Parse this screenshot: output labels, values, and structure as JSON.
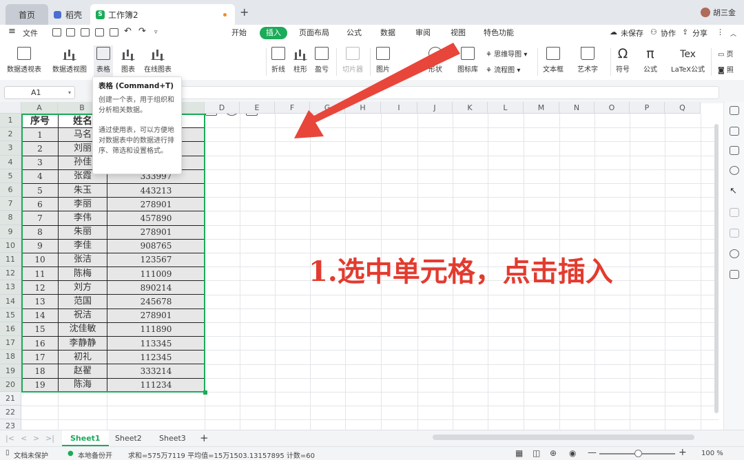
{
  "tabs": {
    "home": "首页",
    "doc": "稻壳",
    "workbook": "工作簿2",
    "new_tab": "+"
  },
  "user": {
    "name": "胡三金"
  },
  "menu": {
    "file": "文件",
    "tabs": [
      "开始",
      "插入",
      "页面布局",
      "公式",
      "数据",
      "审阅",
      "视图",
      "特色功能"
    ],
    "active_tab": "插入",
    "right": {
      "unsaved": "未保存",
      "collab": "协作",
      "share": "分享",
      "more": "⋮"
    }
  },
  "ribbon": {
    "items": [
      "数据透视表",
      "数据透视图",
      "表格",
      "图表",
      "在线图表",
      "折线",
      "柱形",
      "盈亏",
      "切片器",
      "图片",
      "形状",
      "图标库",
      "文本框",
      "艺术字",
      "符号",
      "公式",
      "LaTeX公式",
      "页",
      "照"
    ],
    "mindmap": "思维导图",
    "flowchart": "流程图"
  },
  "formula_bar": {
    "name_box": "A1"
  },
  "tooltip": {
    "title": "表格 (Command+T)",
    "line1": "创建一个表，用于组织和分析相关数据。",
    "line2": "通过使用表，可以方便地对数据表中的数据进行排序、筛选和设置格式。"
  },
  "grid": {
    "columns": [
      "A",
      "B",
      "C",
      "D",
      "E",
      "F",
      "G",
      "H",
      "I",
      "J",
      "K",
      "L",
      "M",
      "N",
      "O",
      "P",
      "Q"
    ],
    "rows": [
      "1",
      "2",
      "3",
      "4",
      "5",
      "6",
      "7",
      "8",
      "9",
      "10",
      "11",
      "12",
      "13",
      "14",
      "15",
      "16",
      "17",
      "18",
      "19",
      "20",
      "21",
      "22",
      "23"
    ],
    "header": [
      "序号",
      "姓名",
      ""
    ],
    "data": [
      [
        "1",
        "马名",
        ""
      ],
      [
        "2",
        "刘丽",
        ""
      ],
      [
        "3",
        "孙佳",
        ""
      ],
      [
        "4",
        "张霞",
        "333997"
      ],
      [
        "5",
        "朱玉",
        "443213"
      ],
      [
        "6",
        "李丽",
        "278901"
      ],
      [
        "7",
        "李伟",
        "457890"
      ],
      [
        "8",
        "朱丽",
        "278901"
      ],
      [
        "9",
        "李佳",
        "908765"
      ],
      [
        "10",
        "张洁",
        "123567"
      ],
      [
        "11",
        "陈梅",
        "111009"
      ],
      [
        "12",
        "刘方",
        "890214"
      ],
      [
        "13",
        "范国",
        "245678"
      ],
      [
        "14",
        "祝洁",
        "278901"
      ],
      [
        "15",
        "沈佳敏",
        "111890"
      ],
      [
        "16",
        "李静静",
        "113345"
      ],
      [
        "17",
        "初礼",
        "112345"
      ],
      [
        "18",
        "赵翟",
        "333214"
      ],
      [
        "19",
        "陈海",
        "111234"
      ]
    ]
  },
  "annotation": {
    "text": "1.选中单元格，点击插入",
    "color": "#e33b2f"
  },
  "sheets": {
    "tabs": [
      "Sheet1",
      "Sheet2",
      "Sheet3"
    ],
    "active": "Sheet1",
    "add": "+"
  },
  "status": {
    "protect": "文档未保护",
    "backup": "本地备份开",
    "stats": "求和=575万7119  平均值=15万1503.13157895  计数=60",
    "zoom": "100 %"
  },
  "colors": {
    "accent": "#1bab59",
    "arrow": "#e8463a"
  }
}
